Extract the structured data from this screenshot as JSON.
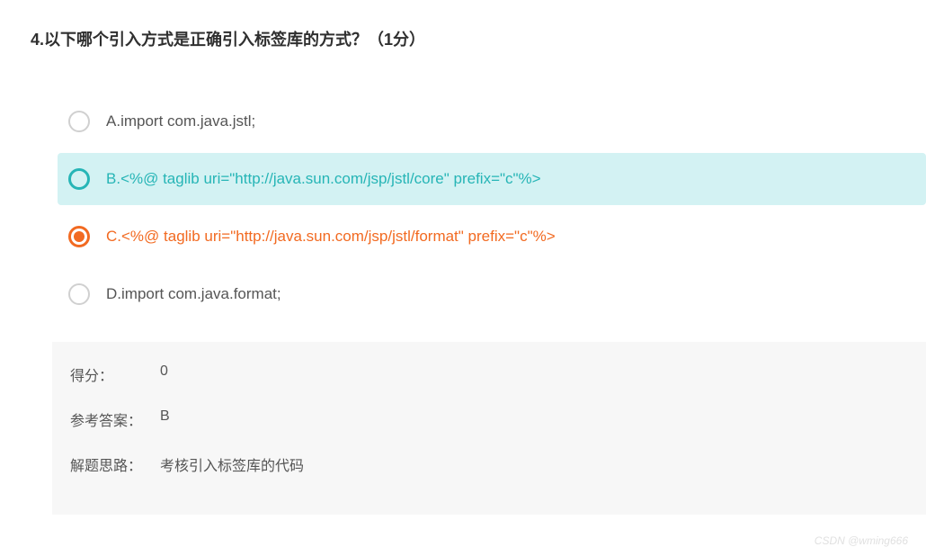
{
  "question": {
    "number": "4.",
    "text": "以下哪个引入方式是正确引入标签库的方式？",
    "points": "（1分）"
  },
  "options": [
    {
      "letter": "A.",
      "text": "import com.java.jstl;",
      "state": "default"
    },
    {
      "letter": "B.",
      "text": "<%@ taglib uri=\"http://java.sun.com/jsp/jstl/core\" prefix=\"c\"%>",
      "state": "highlighted"
    },
    {
      "letter": "C.",
      "text": "<%@ taglib uri=\"http://java.sun.com/jsp/jstl/format\" prefix=\"c\"%>",
      "state": "selected"
    },
    {
      "letter": "D.",
      "text": "import com.java.format;",
      "state": "default"
    }
  ],
  "answer": {
    "score_label": "得分：",
    "score_value": "0",
    "ref_label": "参考答案：",
    "ref_value": "B",
    "explain_label": "解题思路：",
    "explain_value": "考核引入标签库的代码"
  },
  "watermark": "CSDN @wming666"
}
